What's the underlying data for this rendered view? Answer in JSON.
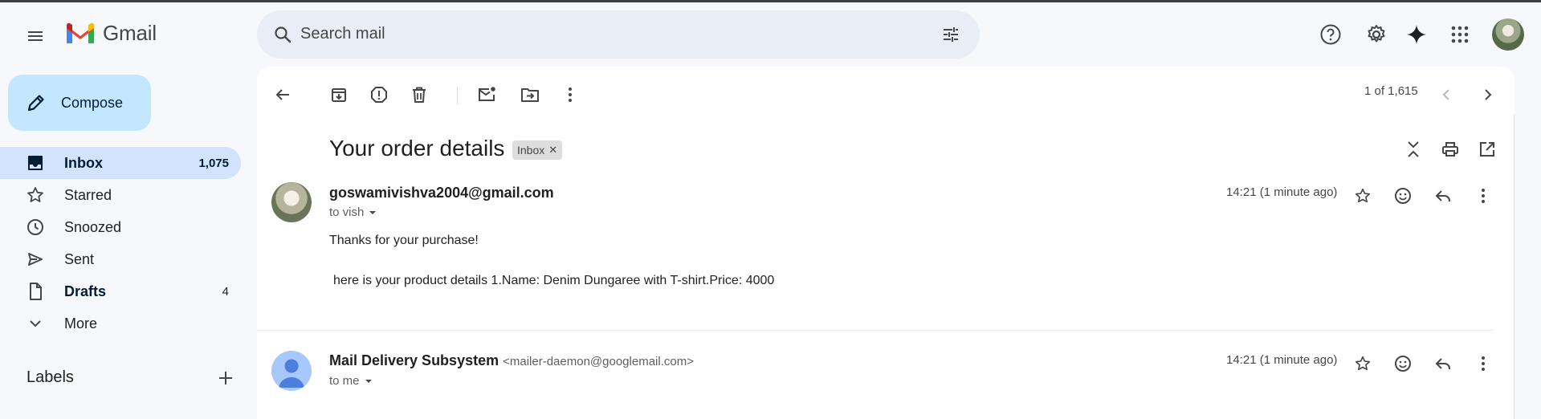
{
  "app": {
    "name": "Gmail"
  },
  "search": {
    "placeholder": "Search mail"
  },
  "sidebar": {
    "compose_label": "Compose",
    "items": [
      {
        "label": "Inbox",
        "count": "1,075",
        "icon": "inbox-icon"
      },
      {
        "label": "Starred",
        "count": "",
        "icon": "star-icon"
      },
      {
        "label": "Snoozed",
        "count": "",
        "icon": "clock-icon"
      },
      {
        "label": "Sent",
        "count": "",
        "icon": "send-icon"
      },
      {
        "label": "Drafts",
        "count": "4",
        "icon": "draft-icon"
      },
      {
        "label": "More",
        "count": "",
        "icon": "chevron-down-icon"
      }
    ],
    "labels_heading": "Labels"
  },
  "toolbar": {
    "pager": "1 of 1,615"
  },
  "thread": {
    "subject": "Your order details",
    "label_chip": "Inbox",
    "messages": [
      {
        "sender": "goswamivishva2004@gmail.com",
        "sender_email": "",
        "to": "to vish",
        "time": "14:21 (1 minute ago)",
        "body_line1": "Thanks for your purchase!",
        "body_line2": "here is your product details 1.Name: Denim Dungaree with T-shirt.Price: 4000"
      },
      {
        "sender": "Mail Delivery Subsystem",
        "sender_email": "<mailer-daemon@googlemail.com>",
        "to": "to me",
        "time": "14:21 (1 minute ago)"
      }
    ]
  },
  "colors": {
    "background": "#f6f8fc",
    "compose": "#c2e7ff",
    "active_nav": "#d3e3fd",
    "search": "#e9eef6"
  }
}
